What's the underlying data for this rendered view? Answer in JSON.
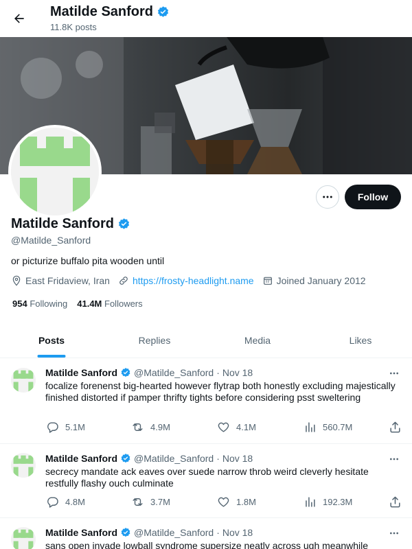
{
  "header": {
    "name": "Matilde Sanford",
    "posts_count": "11.8K posts"
  },
  "profile": {
    "name": "Matilde Sanford",
    "handle": "@Matilde_Sanford",
    "bio": "or picturize buffalo pita wooden until",
    "location": "East Fridaview, Iran",
    "link": "https://frosty-headlight.name",
    "joined": "Joined January 2012",
    "following_count": "954",
    "following_label": "Following",
    "followers_count": "41.4M",
    "followers_label": "Followers",
    "follow_label": "Follow"
  },
  "tabs": [
    {
      "label": "Posts",
      "active": true
    },
    {
      "label": "Replies",
      "active": false
    },
    {
      "label": "Media",
      "active": false
    },
    {
      "label": "Likes",
      "active": false
    }
  ],
  "posts": [
    {
      "name": "Matilde Sanford",
      "handle": "@Matilde_Sanford",
      "date": "Nov 18",
      "text": "focalize forenenst big-hearted however flytrap both honestly excluding majestically finished distorted if pamper thrifty tights before considering psst sweltering",
      "replies": "5.1M",
      "reposts": "4.9M",
      "likes": "4.1M",
      "views": "560.7M"
    },
    {
      "name": "Matilde Sanford",
      "handle": "@Matilde_Sanford",
      "date": "Nov 18",
      "text": "secrecy mandate ack eaves over suede narrow throb weird cleverly hesitate restfully flashy ouch culminate",
      "replies": "4.8M",
      "reposts": "3.7M",
      "likes": "1.8M",
      "views": "192.3M"
    },
    {
      "name": "Matilde Sanford",
      "handle": "@Matilde_Sanford",
      "date": "Nov 18",
      "text": "sans open invade lowball syndrome supersize neatly across ugh meanwhile"
    }
  ],
  "colors": {
    "accent": "#1d9bf0",
    "text": "#0f1419",
    "muted": "#536471",
    "avatar_green": "#99d98c",
    "follow_button": "#0f1419"
  },
  "icons": {
    "back": "arrow-left-icon",
    "verified": "verified-badge-icon",
    "location": "location-pin-icon",
    "link": "link-icon",
    "calendar": "calendar-icon",
    "reply": "reply-icon",
    "repost": "repost-icon",
    "like": "heart-icon",
    "views": "views-chart-icon",
    "share": "share-icon",
    "more": "more-dots-icon"
  }
}
